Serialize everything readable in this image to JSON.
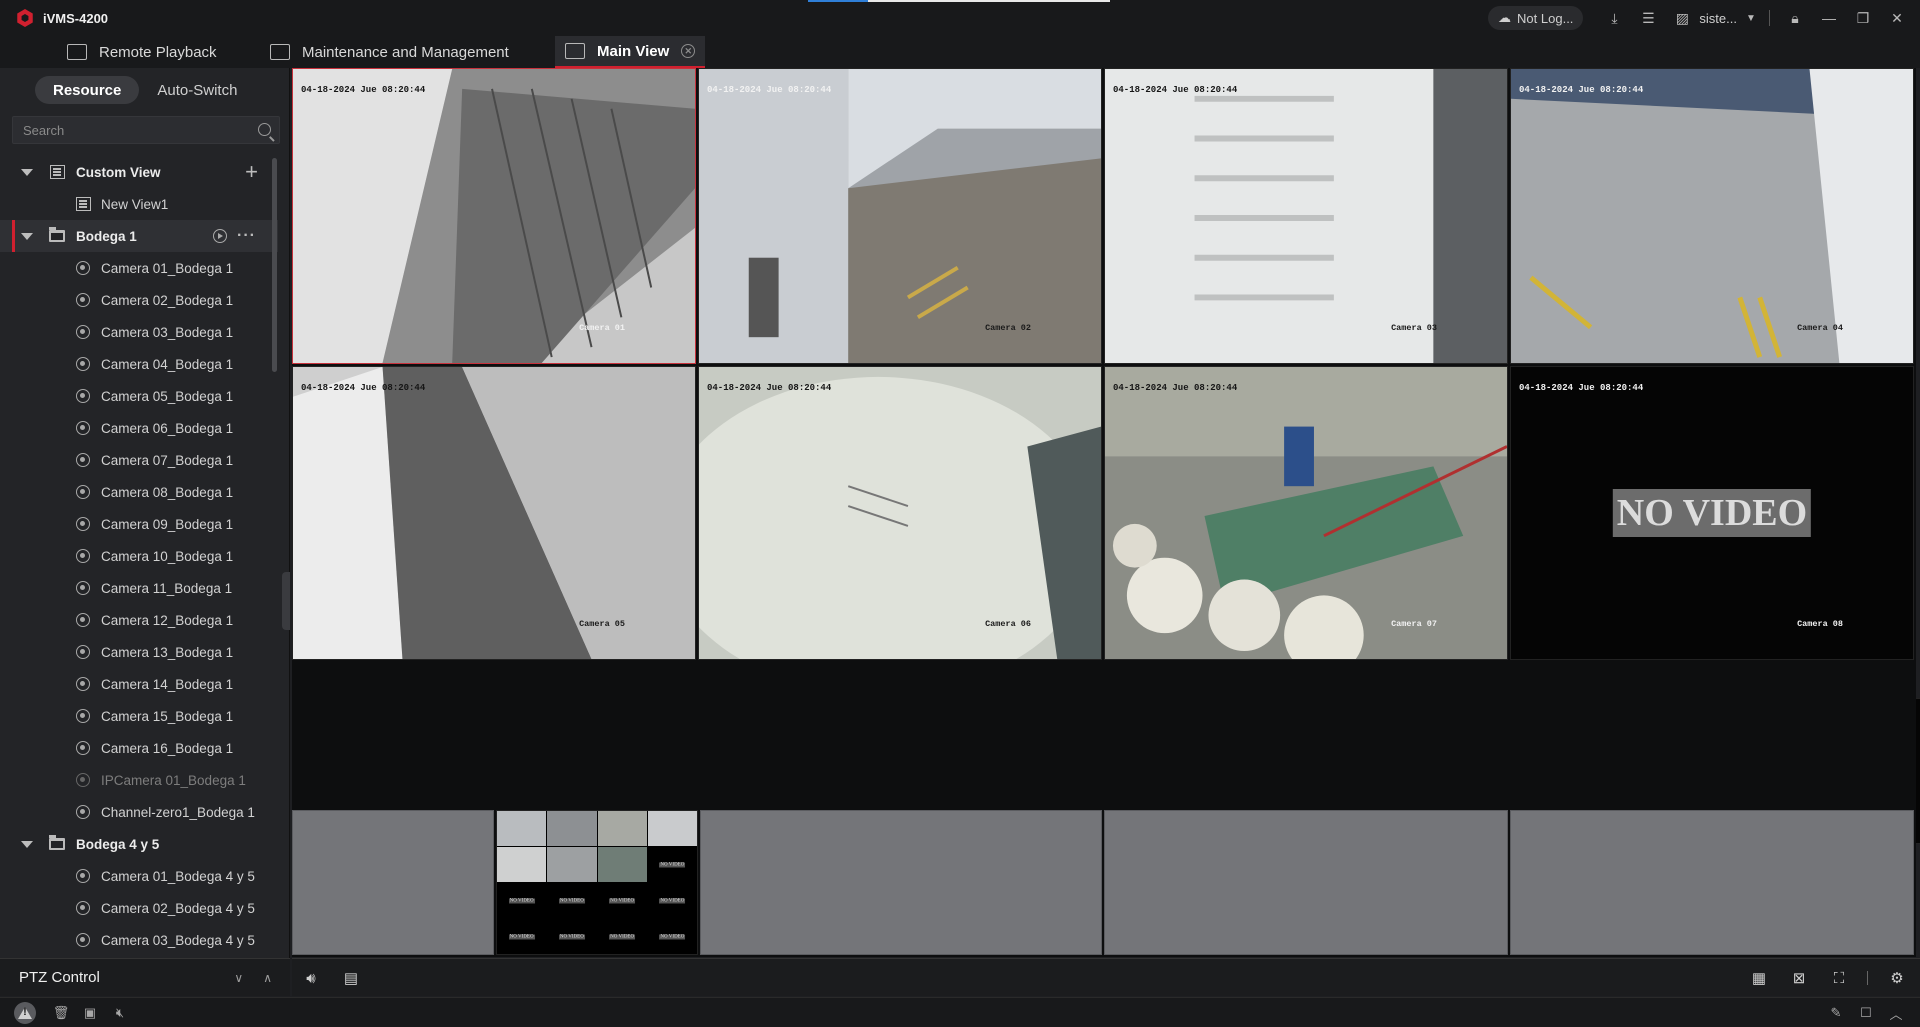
{
  "app": {
    "title": "iVMS-4200"
  },
  "titlebar": {
    "cloud_status": "Not Log...",
    "user": "siste..."
  },
  "tabs": [
    {
      "label": "Remote Playback"
    },
    {
      "label": "Maintenance and Management"
    },
    {
      "label": "Main View"
    }
  ],
  "left": {
    "segment": {
      "resource": "Resource",
      "auto_switch": "Auto-Switch"
    },
    "search_placeholder": "Search",
    "custom_view": {
      "label": "Custom View",
      "items": [
        "New View1"
      ]
    },
    "group1": {
      "label": "Bodega 1",
      "items": [
        "Camera 01_Bodega 1",
        "Camera 02_Bodega 1",
        "Camera 03_Bodega 1",
        "Camera 04_Bodega 1",
        "Camera 05_Bodega 1",
        "Camera 06_Bodega 1",
        "Camera 07_Bodega 1",
        "Camera 08_Bodega 1",
        "Camera 09_Bodega 1",
        "Camera 10_Bodega 1",
        "Camera 11_Bodega 1",
        "Camera 12_Bodega 1",
        "Camera 13_Bodega 1",
        "Camera 14_Bodega 1",
        "Camera 15_Bodega 1",
        "Camera 16_Bodega 1",
        "IPCamera 01_Bodega 1",
        "Channel-zero1_Bodega 1"
      ]
    },
    "group2": {
      "label": "Bodega 4 y 5",
      "items": [
        "Camera 01_Bodega 4 y 5",
        "Camera 02_Bodega 4 y 5",
        "Camera 03_Bodega 4 y 5"
      ]
    },
    "ptz_label": "PTZ Control"
  },
  "video": {
    "osd_date": "04-18-2024 Jue 08:20:44",
    "no_video": "NO VIDEO",
    "large": [
      {
        "name": "Camera 01"
      },
      {
        "name": "Camera 02"
      },
      {
        "name": "Camera 03"
      },
      {
        "name": "Camera 04"
      },
      {
        "name": "Camera 05"
      },
      {
        "name": "Camera 06"
      },
      {
        "name": "Camera 07"
      },
      {
        "name": "Camera 08"
      }
    ]
  },
  "colors": {
    "accent": "#d0202f",
    "background": "#1e1f22"
  }
}
